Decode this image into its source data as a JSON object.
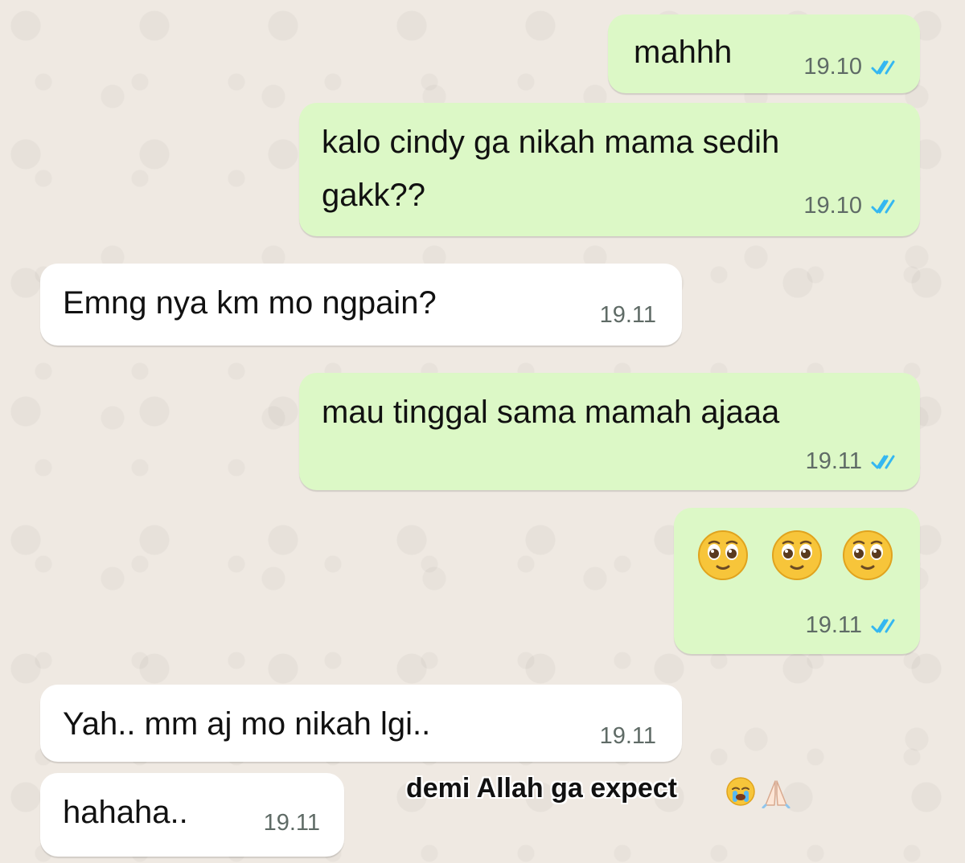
{
  "messages": [
    {
      "text": "mahhh",
      "time": "19.10"
    },
    {
      "text_line1": "kalo cindy ga nikah mama sedih",
      "text_line2": "gakk??",
      "time": "19.10"
    },
    {
      "text": "Emng nya km mo ngpain?",
      "time": "19.11"
    },
    {
      "text": "mau tinggal sama mamah ajaaa",
      "time": "19.11"
    },
    {
      "emoji_count": 3,
      "time": "19.11"
    },
    {
      "text": "Yah.. mm aj mo nikah lgi..",
      "time": "19.11"
    },
    {
      "text": "hahaha..",
      "time": "19.11"
    }
  ],
  "caption": {
    "text": "demi Allah ga expect"
  },
  "colors": {
    "outgoing": "#dcf8c6",
    "incoming": "#ffffff",
    "tick_blue": "#34b7f1"
  }
}
